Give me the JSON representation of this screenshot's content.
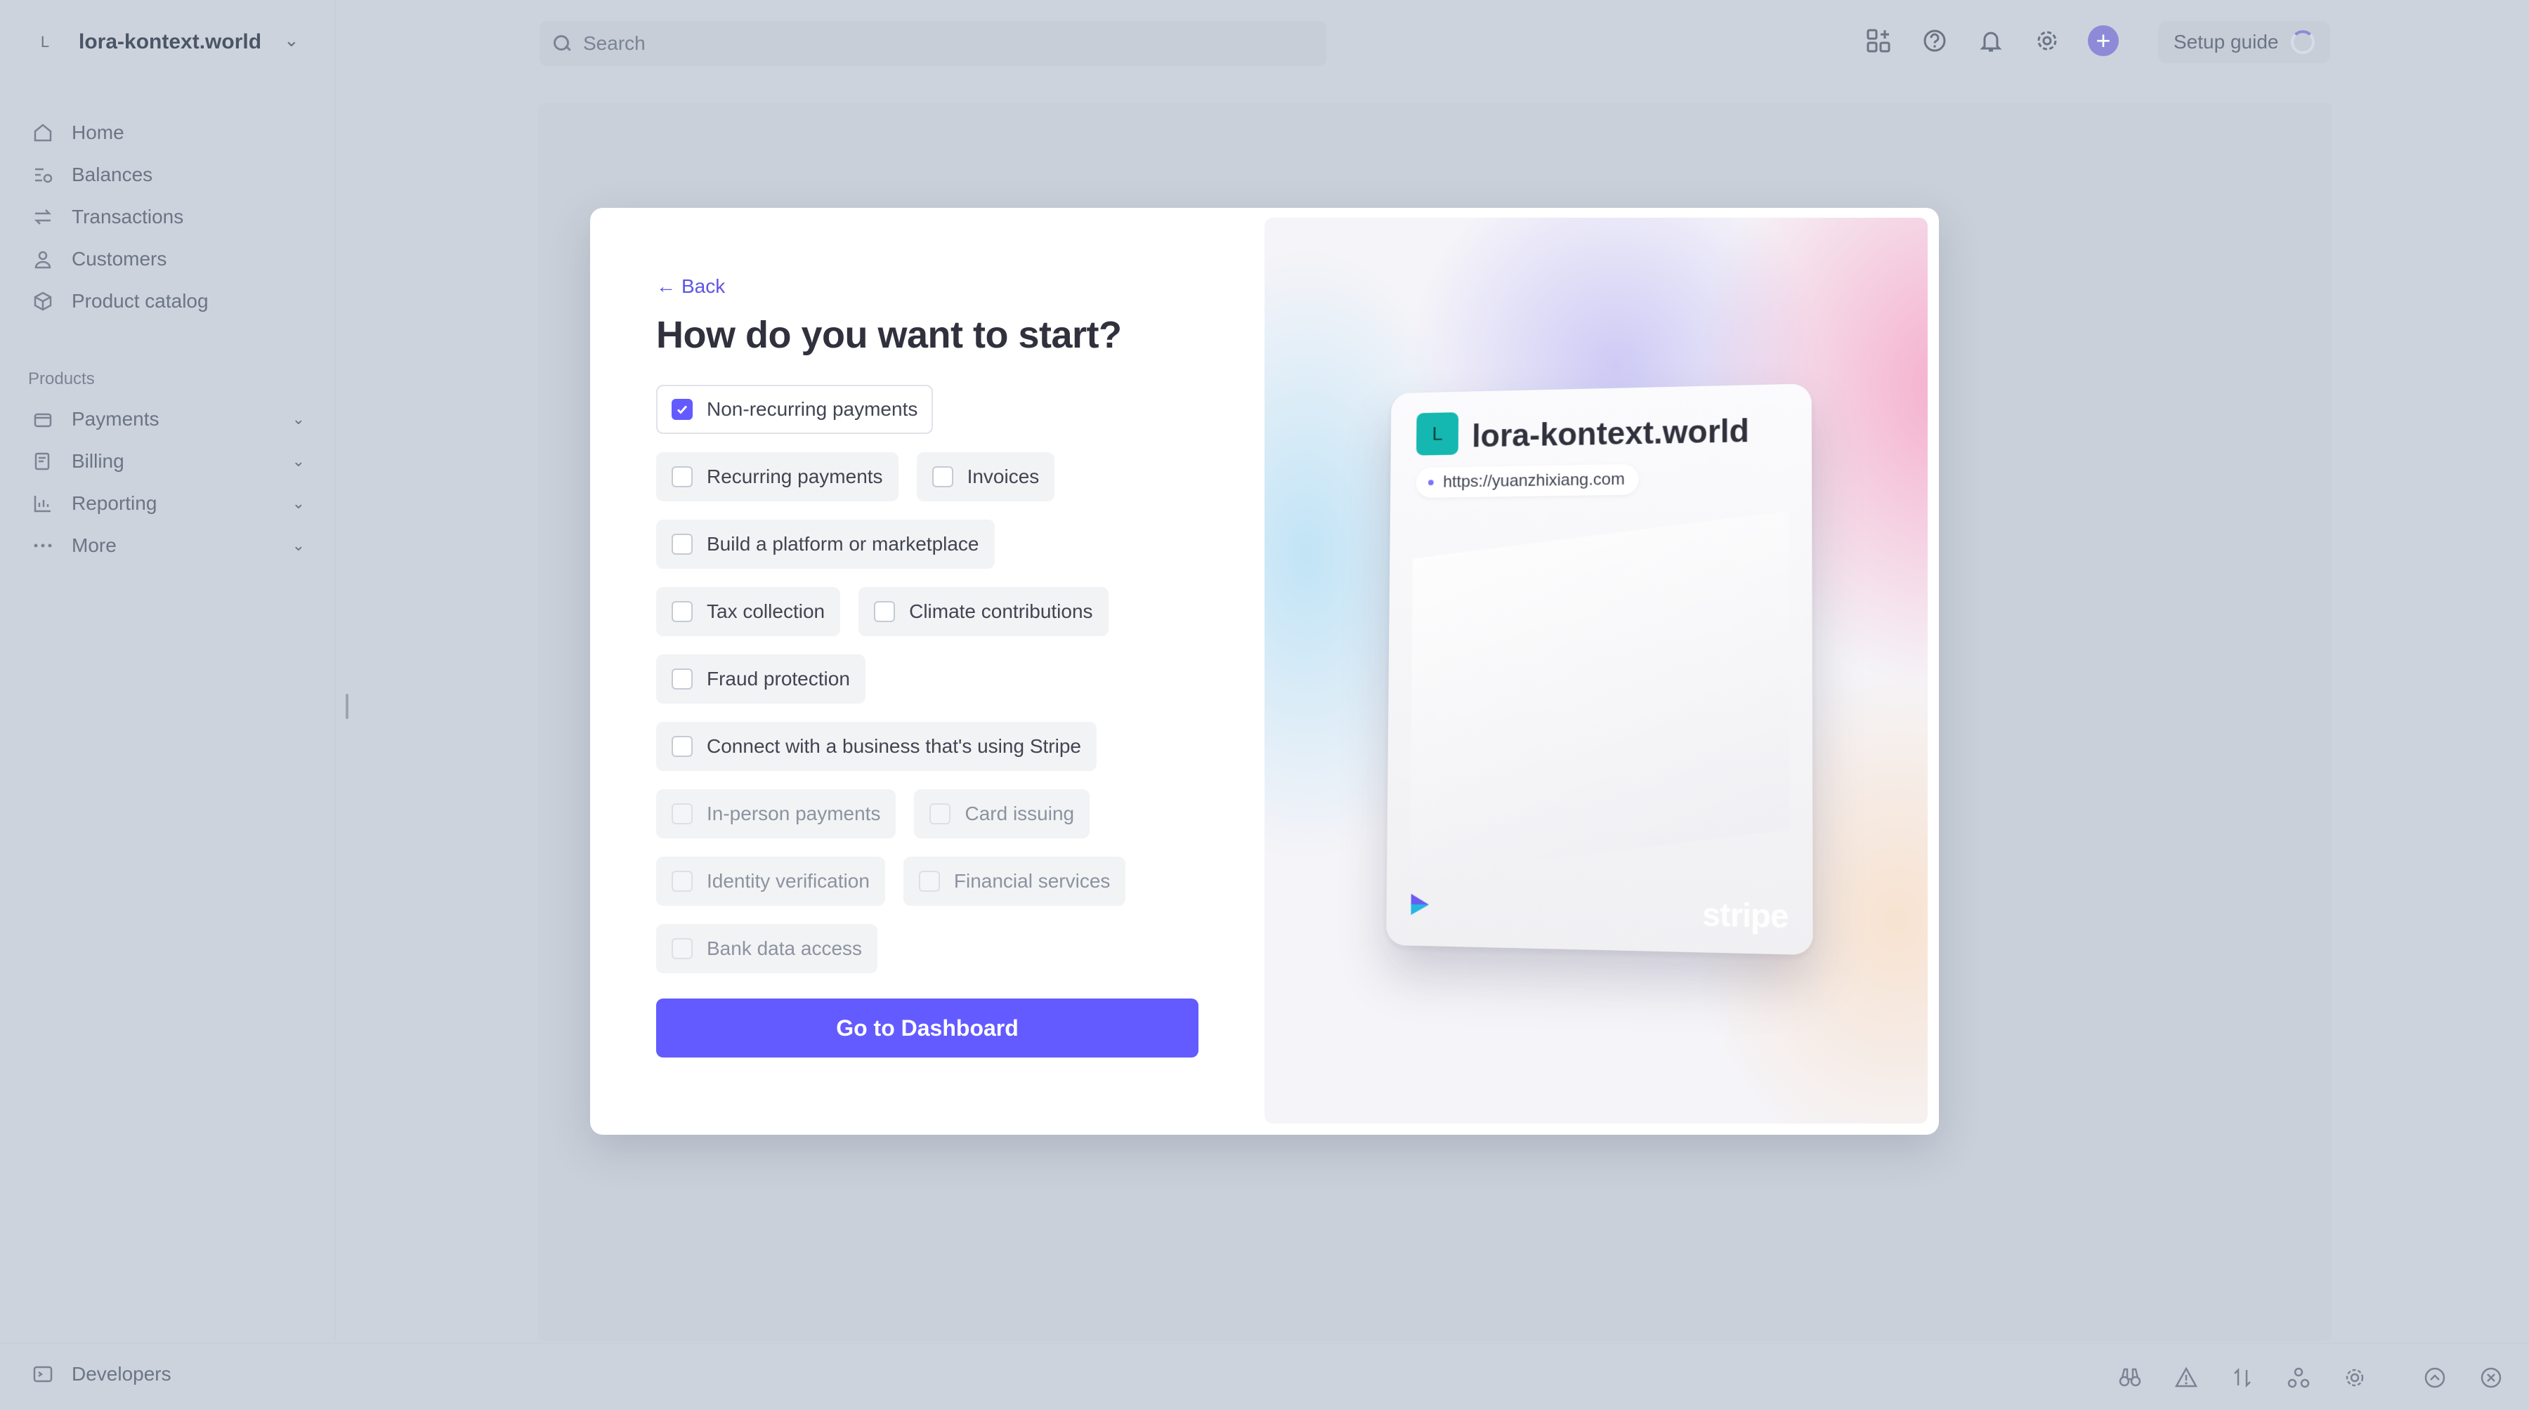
{
  "account": {
    "initial": "L",
    "name": "lora-kontext.world"
  },
  "search": {
    "placeholder": "Search"
  },
  "setup_guide": "Setup guide",
  "sidebar": {
    "items": [
      {
        "label": "Home",
        "icon": "home-icon"
      },
      {
        "label": "Balances",
        "icon": "balances-icon"
      },
      {
        "label": "Transactions",
        "icon": "transactions-icon"
      },
      {
        "label": "Customers",
        "icon": "customer-icon"
      },
      {
        "label": "Product catalog",
        "icon": "box-icon"
      }
    ],
    "section_label": "Products",
    "product_items": [
      {
        "label": "Payments",
        "icon": "wallet-icon"
      },
      {
        "label": "Billing",
        "icon": "billing-icon"
      },
      {
        "label": "Reporting",
        "icon": "chart-icon"
      },
      {
        "label": "More",
        "icon": "more-icon"
      }
    ]
  },
  "bottom": {
    "developers": "Developers"
  },
  "modal": {
    "back": "Back",
    "title": "How do you want to start?",
    "options": {
      "non_recurring": "Non-recurring payments",
      "recurring": "Recurring payments",
      "invoices": "Invoices",
      "platform": "Build a platform or marketplace",
      "tax": "Tax collection",
      "climate": "Climate contributions",
      "fraud": "Fraud protection",
      "connect": "Connect with a business that's using Stripe",
      "in_person": "In-person payments",
      "card_issuing": "Card issuing",
      "identity": "Identity verification",
      "financial": "Financial services",
      "bank_data": "Bank data access"
    },
    "selected": [
      "non_recurring"
    ],
    "cta": "Go to Dashboard",
    "preview": {
      "initial": "L",
      "name": "lora-kontext.world",
      "url": "https://yuanzhixiang.com",
      "brand": "stripe"
    }
  },
  "colors": {
    "accent": "#635bff",
    "logo_teal": "#14b8b0"
  }
}
